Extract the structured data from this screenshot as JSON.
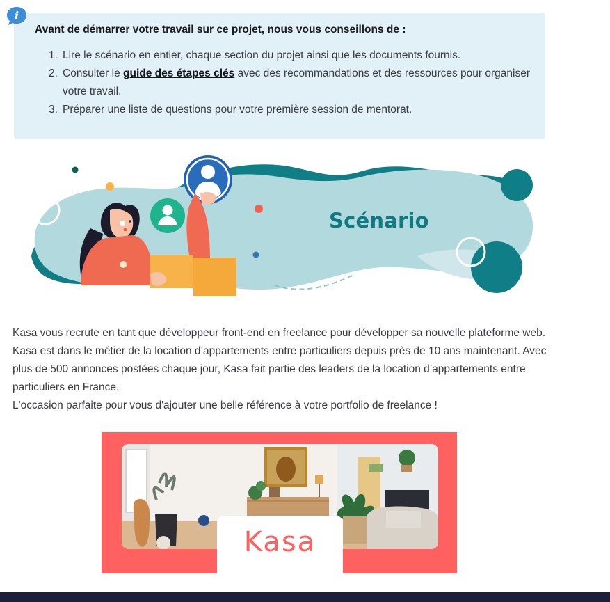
{
  "callout": {
    "heading": "Avant de démarrer votre travail sur ce projet, nous vous conseillons de :",
    "items": [
      {
        "num": "1.",
        "before": "Lire le scénario en entier, chaque section du projet ainsi que les documents fournis.",
        "link": "",
        "after": ""
      },
      {
        "num": "2.",
        "before": "Consulter le ",
        "link": "guide des étapes clés",
        "after": " avec des recommandations et des ressources pour organiser votre travail."
      },
      {
        "num": "3.",
        "before": "Préparer une liste de questions pour votre première session de mentorat.",
        "link": "",
        "after": ""
      }
    ]
  },
  "illustration": {
    "title": "Scénario"
  },
  "scenario": {
    "paragraph": "Kasa vous recrute en tant que développeur front-end en freelance pour développer sa nouvelle plateforme web. Kasa est dans le métier de la location d’appartements entre particuliers depuis près de 10 ans maintenant. Avec plus de 500 annonces postées chaque jour, Kasa fait partie des leaders de la location d’appartements entre particuliers en France.",
    "closing": "L'occasion parfaite pour vous d'ajouter une belle référence à votre portfolio de freelance !"
  },
  "banner": {
    "logo_text": "Kasa"
  },
  "colors": {
    "callout_bg": "#e2f0f8",
    "accent_teal": "#0e7b83",
    "kasa_red": "#ff6060",
    "info_blue": "#3d8ed8"
  }
}
